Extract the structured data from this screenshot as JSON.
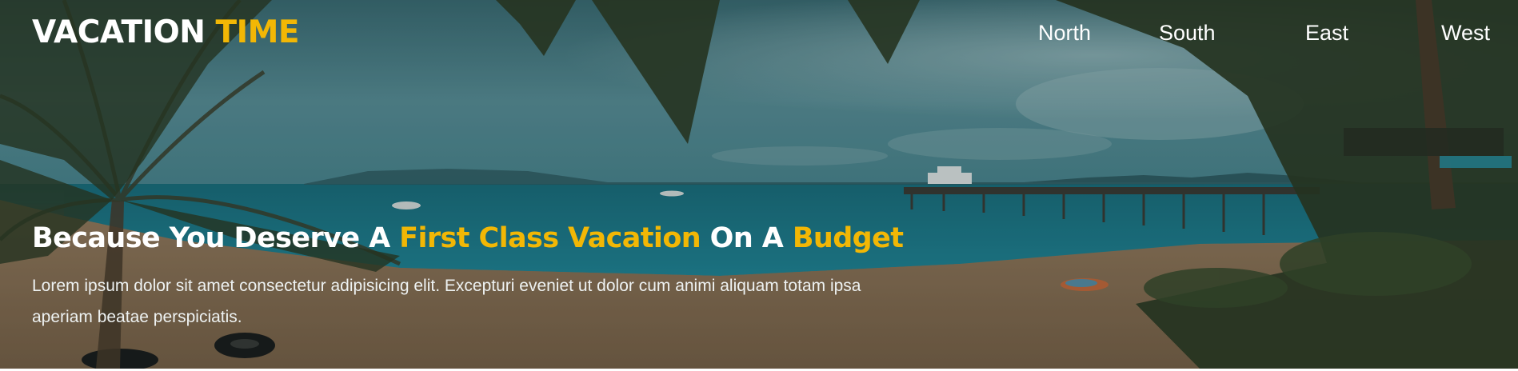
{
  "brand": {
    "logo_part1": "VACATION ",
    "logo_part2": "TIME",
    "accent_color": "#f2b705"
  },
  "nav": {
    "items": [
      "North",
      "South",
      "East",
      "West"
    ]
  },
  "hero": {
    "headline": {
      "part1": "Because You Deserve A ",
      "part2": "First Class Vacation",
      "part3": " On A ",
      "part4": "Budget"
    },
    "subtext": "Lorem ipsum dolor sit amet consectetur adipisicing elit. Excepturi eveniet ut dolor cum animi aliquam totam ipsa aperiam beatae perspiciatis."
  }
}
